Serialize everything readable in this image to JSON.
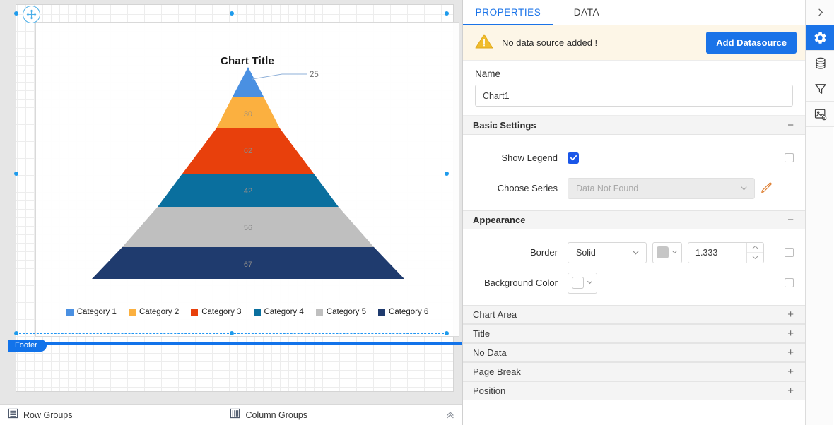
{
  "designer": {
    "move_handle_icon": "move-cross-icon",
    "footer_band_label": "Footer",
    "row_groups_label": "Row Groups",
    "column_groups_label": "Column Groups",
    "row_groups_icon": "row-groups-icon",
    "column_groups_icon": "column-groups-icon",
    "collapse_icon": "chevron-double-up-icon"
  },
  "chart_data": {
    "type": "pie",
    "subtype": "pyramid",
    "title": "Chart Title",
    "xlabel": "",
    "ylabel": "",
    "legend_position": "bottom",
    "grid": false,
    "categories": [
      "Category 1",
      "Category 2",
      "Category 3",
      "Category 4",
      "Category 5",
      "Category 6"
    ],
    "values": [
      25,
      30,
      62,
      42,
      56,
      67
    ],
    "labels": [
      "25",
      "30",
      "62",
      "42",
      "56",
      "67"
    ],
    "colors": [
      "#4a90e2",
      "#fbb040",
      "#e8400c",
      "#0a6f9e",
      "#bfbfbf",
      "#1f3b6e"
    ],
    "callout_label": "25",
    "callout_for": "Category 1"
  },
  "properties_panel": {
    "tabs": [
      {
        "label": "PROPERTIES",
        "active": true
      },
      {
        "label": "DATA",
        "active": false
      }
    ],
    "warning": {
      "icon": "warning-triangle-icon",
      "text": "No data source added !",
      "button_label": "Add Datasource",
      "button_color": "#1a73e8",
      "background": "#fdf6e7"
    },
    "name": {
      "label": "Name",
      "value": "Chart1",
      "placeholder": "Name"
    },
    "basic_settings": {
      "title": "Basic Settings",
      "expanded": true,
      "sign": "−",
      "show_legend": {
        "label": "Show Legend",
        "checked": true,
        "expression_checkbox": false
      },
      "choose_series": {
        "label": "Choose Series",
        "value": "Data Not Found",
        "disabled": true,
        "edit_icon": "pencil-icon"
      }
    },
    "appearance": {
      "title": "Appearance",
      "expanded": true,
      "sign": "−",
      "border": {
        "label": "Border",
        "style": "Solid",
        "color": "#c0c0c0",
        "width": "1.333",
        "expression_checkbox": false
      },
      "background_color": {
        "label": "Background Color",
        "color": "#ffffff",
        "expression_checkbox": false
      }
    },
    "collapsed_sections": [
      {
        "title": "Chart Area",
        "sign": "+"
      },
      {
        "title": "Title",
        "sign": "+"
      },
      {
        "title": "No Data",
        "sign": "+"
      },
      {
        "title": "Page Break",
        "sign": "+"
      },
      {
        "title": "Position",
        "sign": "+"
      }
    ]
  },
  "rail": {
    "items": [
      {
        "icon": "chevron-right-icon",
        "name": "expand-panel",
        "active": false
      },
      {
        "icon": "gear-icon",
        "name": "settings",
        "active": true
      },
      {
        "icon": "database-icon",
        "name": "datasource",
        "active": false
      },
      {
        "icon": "filter-icon",
        "name": "filter",
        "active": false
      },
      {
        "icon": "image-settings-icon",
        "name": "image-settings",
        "active": false
      }
    ]
  }
}
